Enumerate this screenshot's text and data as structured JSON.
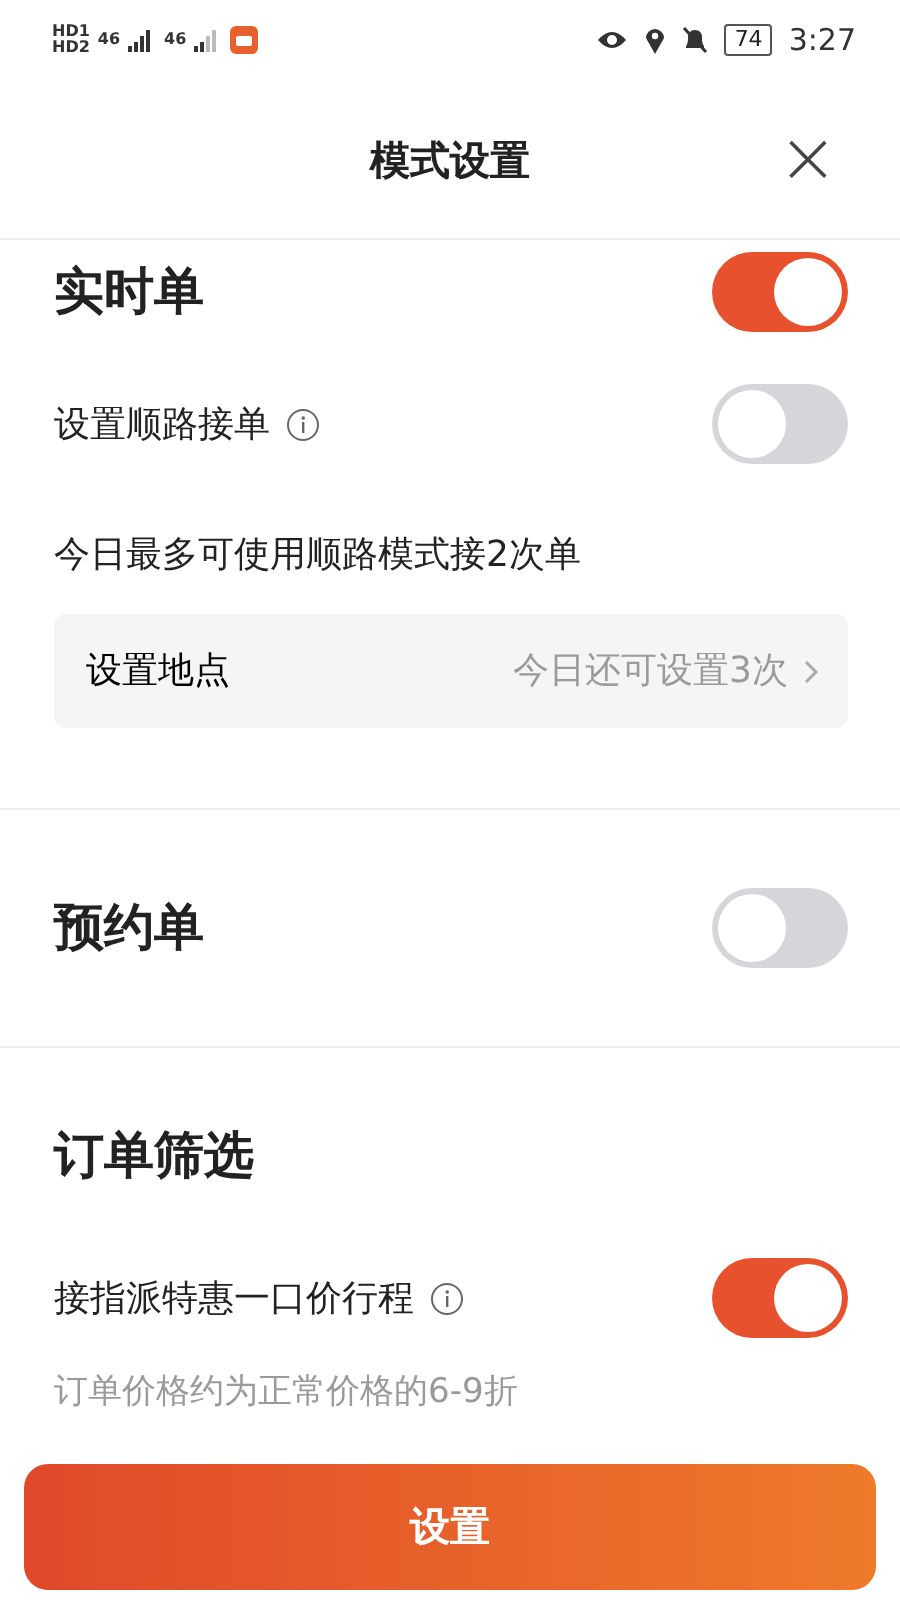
{
  "status_bar": {
    "sims": [
      {
        "label": "HD1",
        "network": "46"
      },
      {
        "label": "HD2",
        "network": "46"
      }
    ],
    "battery": "74",
    "time": "3:27"
  },
  "header": {
    "title": "模式设置",
    "close": "×"
  },
  "sections": [
    {
      "title": "实时单",
      "on": true,
      "rows": [
        {
          "kind": "toggle",
          "label": "设置顺路接单",
          "info": true,
          "on": false
        },
        {
          "kind": "note",
          "text": "今日最多可使用顺路模式接2次单"
        },
        {
          "kind": "link",
          "label": "设置地点",
          "value": "今日还可设置3次"
        }
      ]
    },
    {
      "title": "预约单",
      "on": false
    },
    {
      "title": "订单筛选",
      "rows": [
        {
          "kind": "toggle",
          "label": "接指派特惠一口价行程",
          "info": true,
          "on": true
        },
        {
          "kind": "hint",
          "text": "订单价格约为正常价格的6-9折"
        }
      ]
    }
  ],
  "button": {
    "label": "设置"
  }
}
